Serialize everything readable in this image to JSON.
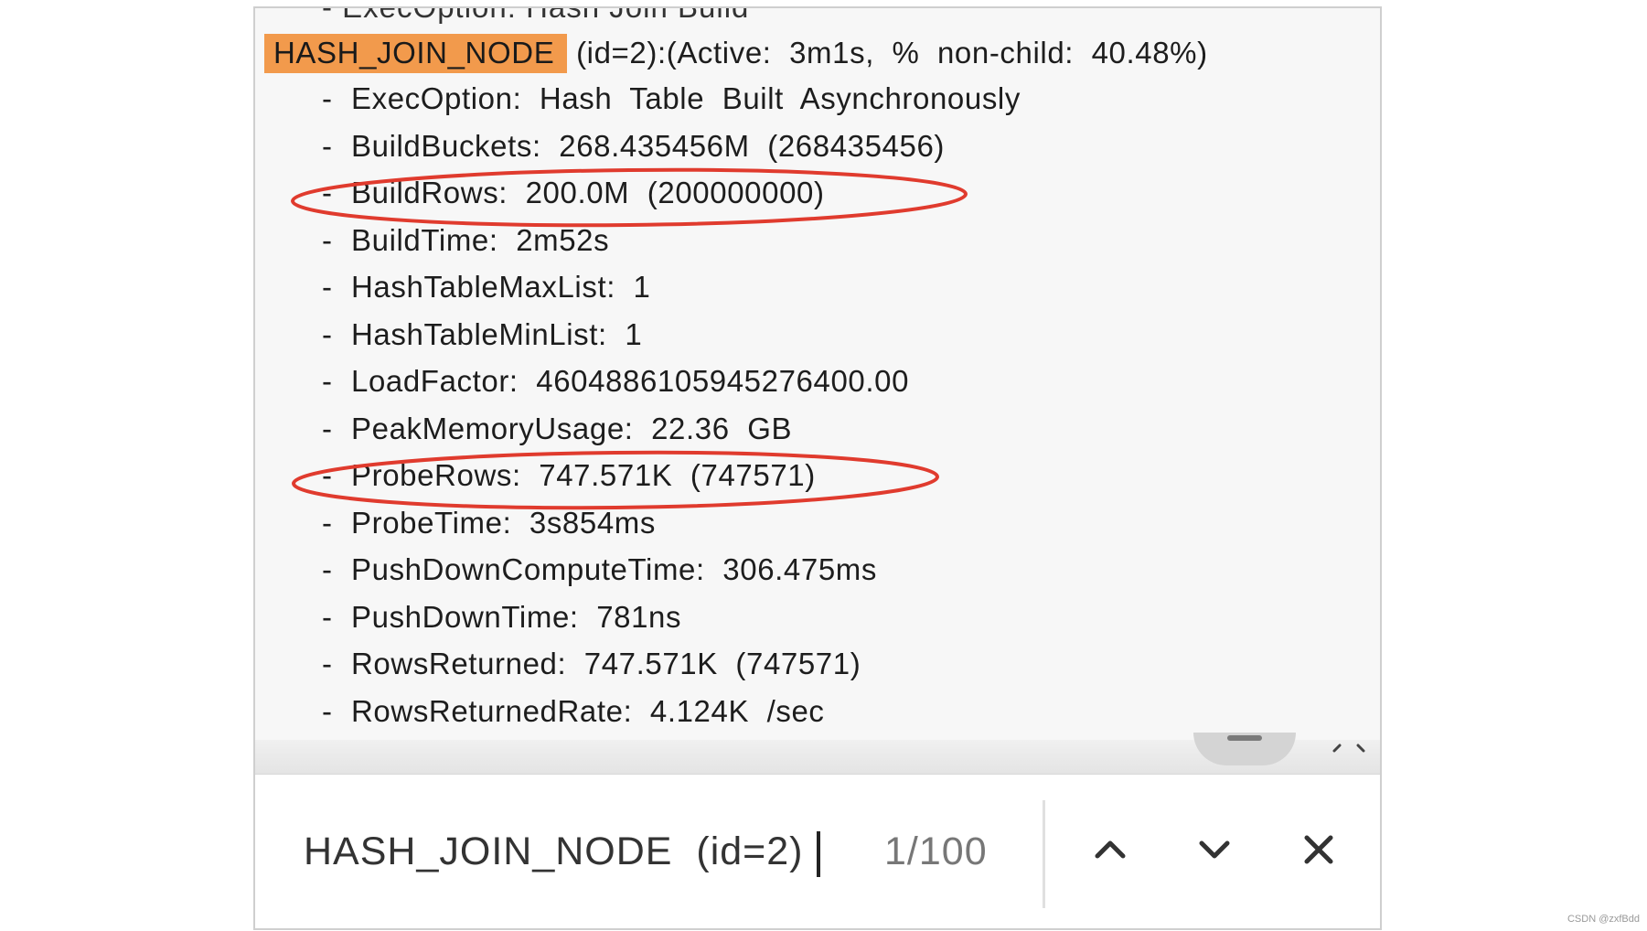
{
  "profile": {
    "clipped_line": "- ExecOption: Hash Join Build",
    "node_name": "HASH_JOIN_NODE",
    "node_details": " (id=2):(Active:  3m1s,  %  non-child:  40.48%)",
    "dash": "-",
    "metrics": [
      {
        "name": "ExecOption",
        "text": "ExecOption:  Hash  Table  Built  Asynchronously",
        "circled": false
      },
      {
        "name": "BuildBuckets",
        "text": "BuildBuckets:  268.435456M  (268435456)",
        "circled": false
      },
      {
        "name": "BuildRows",
        "text": "BuildRows:  200.0M  (200000000)",
        "circled": true
      },
      {
        "name": "BuildTime",
        "text": "BuildTime:  2m52s",
        "circled": false
      },
      {
        "name": "HashTableMaxList",
        "text": "HashTableMaxList:  1",
        "circled": false
      },
      {
        "name": "HashTableMinList",
        "text": "HashTableMinList:  1",
        "circled": false
      },
      {
        "name": "LoadFactor",
        "text": "LoadFactor:  4604886105945276400.00",
        "circled": false
      },
      {
        "name": "PeakMemoryUsage",
        "text": "PeakMemoryUsage:  22.36  GB",
        "circled": false
      },
      {
        "name": "ProbeRows",
        "text": "ProbeRows:  747.571K  (747571)",
        "circled": true
      },
      {
        "name": "ProbeTime",
        "text": "ProbeTime:  3s854ms",
        "circled": false
      },
      {
        "name": "PushDownComputeTime",
        "text": "PushDownComputeTime:  306.475ms",
        "circled": false
      },
      {
        "name": "PushDownTime",
        "text": "PushDownTime:  781ns",
        "circled": false
      },
      {
        "name": "RowsReturned",
        "text": "RowsReturned:  747.571K  (747571)",
        "circled": false
      },
      {
        "name": "RowsReturnedRate",
        "text": "RowsReturnedRate:  4.124K  /sec",
        "circled": false
      }
    ]
  },
  "find_bar": {
    "query": "HASH_JOIN_NODE  (id=2)",
    "match_count": "1/100",
    "prev_icon": "chevron-up-icon",
    "next_icon": "chevron-down-icon",
    "close_icon": "close-icon"
  },
  "colors": {
    "highlight": "#f29a4c",
    "annotation": "#e03b2e",
    "panel_background": "#f7f7f7"
  },
  "watermark": "CSDN @zxfBdd"
}
